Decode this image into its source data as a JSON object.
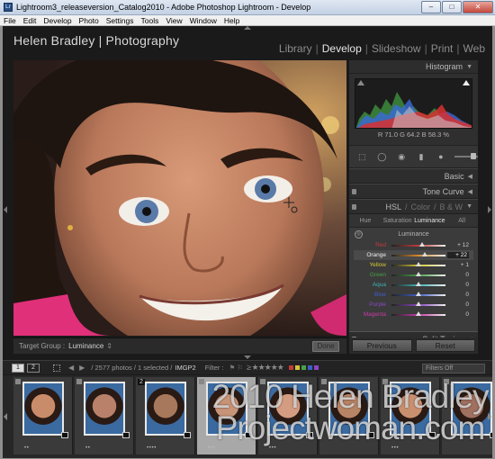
{
  "window": {
    "title": "Lightroom3_releaseversion_Catalog2010 - Adobe Photoshop Lightroom - Develop",
    "controls": {
      "minimize": "–",
      "maximize": "□",
      "close": "✕"
    }
  },
  "menubar": [
    "File",
    "Edit",
    "Develop",
    "Photo",
    "Settings",
    "Tools",
    "View",
    "Window",
    "Help"
  ],
  "identity_plate": "Helen Bradley | Photography",
  "modules": [
    {
      "label": "Library",
      "active": false
    },
    {
      "label": "Develop",
      "active": true
    },
    {
      "label": "Slideshow",
      "active": false
    },
    {
      "label": "Print",
      "active": false
    },
    {
      "label": "Web",
      "active": false
    }
  ],
  "toolbar": {
    "target_group_label": "Target Group :",
    "target_group_value": "Luminance",
    "done_label": "Done"
  },
  "histogram": {
    "title": "Histogram",
    "readout": "R 71.0   G 64.2   B 58.3 %"
  },
  "panels": {
    "basic": "Basic",
    "tone_curve": "Tone Curve",
    "hsl": {
      "hsl": "HSL",
      "color": "Color",
      "bw": "B & W"
    },
    "split_toning": "Split Toning"
  },
  "hsl_tabs": [
    {
      "label": "Hue",
      "active": false
    },
    {
      "label": "Saturation",
      "active": false
    },
    {
      "label": "Luminance",
      "active": true
    },
    {
      "label": "All",
      "active": false
    }
  ],
  "luminance": {
    "heading": "Luminance",
    "sliders": [
      {
        "label": "Red",
        "value": "+ 12",
        "amount": 12,
        "color": "#c43b3b",
        "selected": false
      },
      {
        "label": "Orange",
        "value": "+ 22",
        "amount": 22,
        "color": "#d88a2c",
        "selected": true
      },
      {
        "label": "Yellow",
        "value": "+ 1",
        "amount": 1,
        "color": "#d6c834",
        "selected": false
      },
      {
        "label": "Green",
        "value": "0",
        "amount": 0,
        "color": "#49a048",
        "selected": false
      },
      {
        "label": "Aqua",
        "value": "0",
        "amount": 0,
        "color": "#3fb3b3",
        "selected": false
      },
      {
        "label": "Blue",
        "value": "0",
        "amount": 0,
        "color": "#3f5fc8",
        "selected": false
      },
      {
        "label": "Purple",
        "value": "0",
        "amount": 0,
        "color": "#8a47c2",
        "selected": false
      },
      {
        "label": "Magenta",
        "value": "0",
        "amount": 0,
        "color": "#c83ca8",
        "selected": false
      }
    ]
  },
  "buttons": {
    "previous": "Previous",
    "reset": "Reset"
  },
  "filmstrip_bar": {
    "view1": "1",
    "view2": "2",
    "info_prefix": "/ 2577 photos / 1 selected /",
    "filename": "IMGP2",
    "filter_label": "Filter :",
    "filters_off": "Filters Off",
    "label_colors": [
      "#c23a3a",
      "#d6c534",
      "#4aa048",
      "#3c5fc8",
      "#8a46c4"
    ]
  },
  "filmstrip": {
    "frames": [
      {
        "stars": "• •",
        "selected": false,
        "number": ""
      },
      {
        "stars": "• •",
        "selected": false,
        "number": ""
      },
      {
        "stars": "• • • •",
        "selected": false,
        "number": "2"
      },
      {
        "stars": "• • •",
        "selected": true,
        "number": ""
      },
      {
        "stars": "• • •",
        "selected": false,
        "number": ""
      },
      {
        "stars": "",
        "selected": false,
        "number": ""
      },
      {
        "stars": "• • •",
        "selected": false,
        "number": ""
      },
      {
        "stars": "",
        "selected": false,
        "number": ""
      }
    ]
  },
  "watermark": "2010 Helen Bradley\nProjectwoman.com"
}
